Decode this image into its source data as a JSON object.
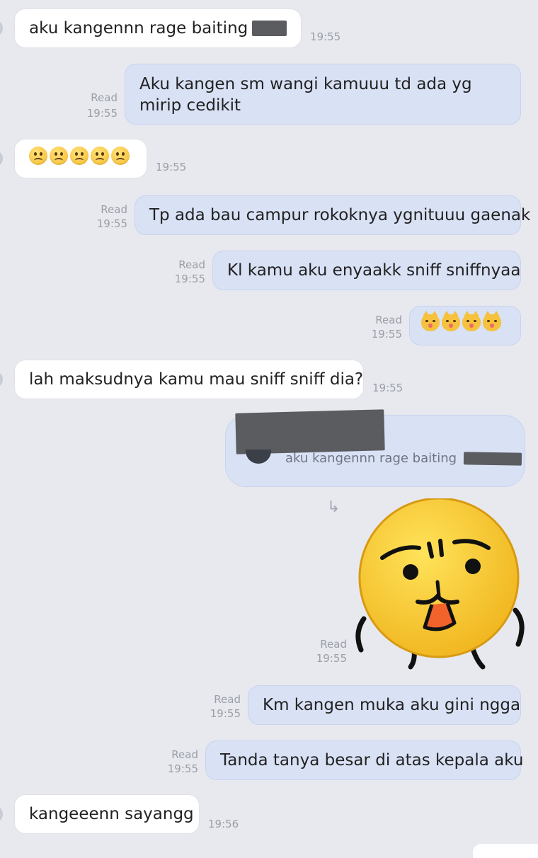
{
  "messages": [
    {
      "id": "m1",
      "dir": "in",
      "text": "aku kangennn rage baiting",
      "time": "19:55"
    },
    {
      "id": "m2",
      "dir": "out",
      "text": "Aku kangen sm wangi kamuuu td ada yg mirip cedikit",
      "status": "Read",
      "time": "19:55"
    },
    {
      "id": "m3",
      "dir": "in",
      "emoji": "sad-face x5",
      "time": "19:55"
    },
    {
      "id": "m4",
      "dir": "out",
      "text": "Tp ada bau campur rokoknya ygnituuu gaenak",
      "status": "Read",
      "time": "19:55"
    },
    {
      "id": "m5",
      "dir": "out",
      "text": "Kl kamu aku enyaakk sniff sniffnyaa",
      "status": "Read",
      "time": "19:55"
    },
    {
      "id": "m6",
      "dir": "out",
      "emoji": "cat-face x4",
      "status": "Read",
      "time": "19:55"
    },
    {
      "id": "m7",
      "dir": "in",
      "text": "lah maksudnya kamu mau sniff sniff dia?",
      "time": "19:55"
    },
    {
      "id": "m8",
      "dir": "out",
      "reply_quote": "aku kangennn rage baiting",
      "sticker": "yellow-face-sticker",
      "status": "Read",
      "time": "19:55"
    },
    {
      "id": "m9",
      "dir": "out",
      "text": "Km kangen muka aku gini ngga",
      "status": "Read",
      "time": "19:55"
    },
    {
      "id": "m10",
      "dir": "out",
      "text": "Tanda tanya besar di atas kepala aku",
      "status": "Read",
      "time": "19:55"
    },
    {
      "id": "m11",
      "dir": "in",
      "text": "kangeeenn sayangg",
      "time": "19:56"
    }
  ],
  "colors": {
    "background": "#e7e9ee",
    "incoming_bubble": "#ffffff",
    "outgoing_bubble": "#d9e1f5",
    "meta_text": "#9a9ea8",
    "redaction": "#5a5c60"
  }
}
